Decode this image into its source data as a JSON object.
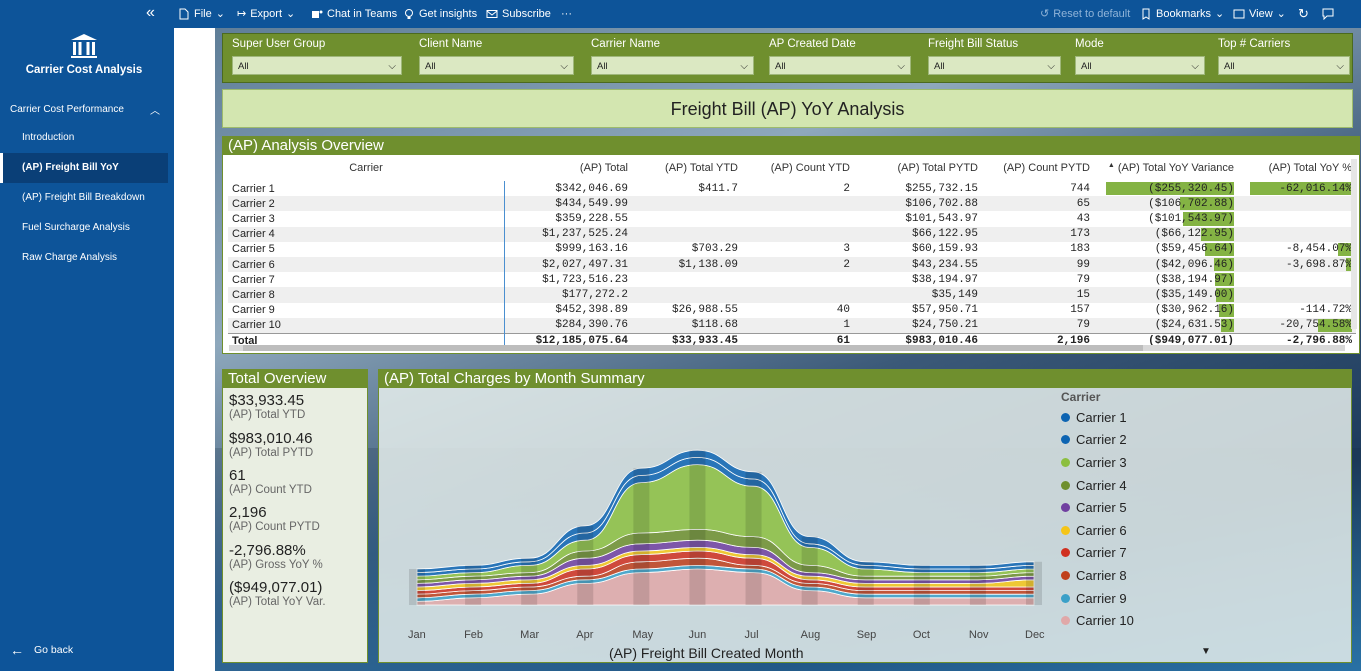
{
  "toolbar": {
    "file": "File",
    "export": "Export",
    "chat": "Chat in Teams",
    "insights": "Get insights",
    "subscribe": "Subscribe",
    "more": "···",
    "reset": "Reset to default",
    "bookmarks": "Bookmarks",
    "view": "View"
  },
  "sidebar": {
    "app_title": "Carrier Cost Analysis",
    "section": "Carrier Cost Performance",
    "items": [
      {
        "label": "Introduction"
      },
      {
        "label": "(AP) Freight Bill YoY"
      },
      {
        "label": "(AP) Freight Bill Breakdown"
      },
      {
        "label": "Fuel Surcharge Analysis"
      },
      {
        "label": "Raw Charge Analysis"
      }
    ],
    "go_back": "Go back"
  },
  "slicers": [
    {
      "label": "Super User Group",
      "value": "All"
    },
    {
      "label": "Client Name",
      "value": "All"
    },
    {
      "label": "Carrier Name",
      "value": "All"
    },
    {
      "label": "AP Created Date",
      "value": "All"
    },
    {
      "label": "Freight Bill Status",
      "value": "All"
    },
    {
      "label": "Mode",
      "value": "All"
    },
    {
      "label": "Top # Carriers",
      "value": "All"
    }
  ],
  "page_title": "Freight Bill (AP) YoY Analysis",
  "overview": {
    "title": "(AP) Analysis Overview",
    "columns": [
      "Carrier",
      "(AP) Total",
      "(AP) Total YTD",
      "(AP) Count YTD",
      "(AP) Total PYTD",
      "(AP) Count PYTD",
      "(AP) Total YoY Variance",
      "(AP) Total YoY %"
    ],
    "rows": [
      {
        "carrier": "Carrier 1",
        "total": "$342,046.69",
        "ytd": "$411.7",
        "count_ytd": "2",
        "pytd": "$255,732.15",
        "count_pytd": "744",
        "variance": "($255,320.45)",
        "var_frac": 1.0,
        "yoy": "-62,016.14%",
        "yoy_frac": 1.0
      },
      {
        "carrier": "Carrier 2",
        "total": "$434,549.99",
        "ytd": "",
        "count_ytd": "",
        "pytd": "$106,702.88",
        "count_pytd": "65",
        "variance": "($106,702.88)",
        "var_frac": 0.42,
        "yoy": "",
        "yoy_frac": 0
      },
      {
        "carrier": "Carrier 3",
        "total": "$359,228.55",
        "ytd": "",
        "count_ytd": "",
        "pytd": "$101,543.97",
        "count_pytd": "43",
        "variance": "($101,543.97)",
        "var_frac": 0.4,
        "yoy": "",
        "yoy_frac": 0
      },
      {
        "carrier": "Carrier 4",
        "total": "$1,237,525.24",
        "ytd": "",
        "count_ytd": "",
        "pytd": "$66,122.95",
        "count_pytd": "173",
        "variance": "($66,122.95)",
        "var_frac": 0.26,
        "yoy": "",
        "yoy_frac": 0
      },
      {
        "carrier": "Carrier 5",
        "total": "$999,163.16",
        "ytd": "$703.29",
        "count_ytd": "3",
        "pytd": "$60,159.93",
        "count_pytd": "183",
        "variance": "($59,456.64)",
        "var_frac": 0.23,
        "yoy": "-8,454.07%",
        "yoy_frac": 0.14
      },
      {
        "carrier": "Carrier 6",
        "total": "$2,027,497.31",
        "ytd": "$1,138.09",
        "count_ytd": "2",
        "pytd": "$43,234.55",
        "count_pytd": "99",
        "variance": "($42,096.46)",
        "var_frac": 0.16,
        "yoy": "-3,698.87%",
        "yoy_frac": 0.06
      },
      {
        "carrier": "Carrier 7",
        "total": "$1,723,516.23",
        "ytd": "",
        "count_ytd": "",
        "pytd": "$38,194.97",
        "count_pytd": "79",
        "variance": "($38,194.97)",
        "var_frac": 0.15,
        "yoy": "",
        "yoy_frac": 0
      },
      {
        "carrier": "Carrier 8",
        "total": "$177,272.2",
        "ytd": "",
        "count_ytd": "",
        "pytd": "$35,149",
        "count_pytd": "15",
        "variance": "($35,149.00)",
        "var_frac": 0.14,
        "yoy": "",
        "yoy_frac": 0
      },
      {
        "carrier": "Carrier 9",
        "total": "$452,398.89",
        "ytd": "$26,988.55",
        "count_ytd": "40",
        "pytd": "$57,950.71",
        "count_pytd": "157",
        "variance": "($30,962.16)",
        "var_frac": 0.12,
        "yoy": "-114.72%",
        "yoy_frac": 0.0
      },
      {
        "carrier": "Carrier 10",
        "total": "$284,390.76",
        "ytd": "$118.68",
        "count_ytd": "1",
        "pytd": "$24,750.21",
        "count_pytd": "79",
        "variance": "($24,631.53)",
        "var_frac": 0.1,
        "yoy": "-20,754.58%",
        "yoy_frac": 0.33
      }
    ],
    "total": {
      "carrier": "Total",
      "total": "$12,185,075.64",
      "ytd": "$33,933.45",
      "count_ytd": "61",
      "pytd": "$983,010.46",
      "count_pytd": "2,196",
      "variance": "($949,077.01)",
      "yoy": "-2,796.88%"
    }
  },
  "kpis": {
    "title": "Total Overview",
    "items": [
      {
        "value": "$33,933.45",
        "label": "(AP) Total YTD"
      },
      {
        "value": "$983,010.46",
        "label": "(AP) Total PYTD"
      },
      {
        "value": "61",
        "label": "(AP) Count YTD"
      },
      {
        "value": "2,196",
        "label": "(AP) Count PYTD"
      },
      {
        "value": "-2,796.88%",
        "label": "(AP) Gross YoY %"
      },
      {
        "value": "($949,077.01)",
        "label": "(AP) Total YoY Var."
      }
    ]
  },
  "chart": {
    "title": "(AP) Total Charges by Month Summary",
    "x_title": "(AP) Freight Bill Created Month",
    "legend_title": "Carrier"
  },
  "chart_data": {
    "type": "area",
    "x": [
      "Jan",
      "Feb",
      "Mar",
      "Apr",
      "May",
      "Jun",
      "Jul",
      "Aug",
      "Sep",
      "Oct",
      "Nov",
      "Dec"
    ],
    "series": [
      {
        "name": "Carrier 1",
        "color": "#0d64b2",
        "values": [
          1,
          1,
          1,
          2,
          2,
          2,
          2,
          2,
          1,
          1,
          1,
          1
        ]
      },
      {
        "name": "Carrier 2",
        "color": "#0d64b2",
        "values": [
          1,
          1,
          1,
          2,
          2,
          2,
          2,
          1,
          1,
          1,
          1,
          1
        ]
      },
      {
        "name": "Carrier 3",
        "color": "#8cbf3f",
        "values": [
          1,
          1,
          2,
          3,
          14,
          18,
          14,
          5,
          2,
          1,
          1,
          1
        ]
      },
      {
        "name": "Carrier 4",
        "color": "#6f8f2e",
        "values": [
          1,
          1,
          1,
          2,
          3,
          3,
          3,
          2,
          1,
          1,
          1,
          1
        ]
      },
      {
        "name": "Carrier 5",
        "color": "#7040a0",
        "values": [
          1,
          1,
          1,
          2,
          2,
          2,
          2,
          1,
          1,
          1,
          1,
          1
        ]
      },
      {
        "name": "Carrier 6",
        "color": "#f5c518",
        "values": [
          1,
          1,
          1,
          1,
          1,
          1,
          1,
          1,
          1,
          1,
          1,
          2
        ]
      },
      {
        "name": "Carrier 7",
        "color": "#d03020",
        "values": [
          1,
          1,
          1,
          2,
          2,
          2,
          2,
          1,
          1,
          1,
          1,
          1
        ]
      },
      {
        "name": "Carrier 8",
        "color": "#c0401c",
        "values": [
          1,
          1,
          1,
          1,
          2,
          2,
          1,
          1,
          1,
          1,
          1,
          1
        ]
      },
      {
        "name": "Carrier 9",
        "color": "#3aa0c8",
        "values": [
          1,
          1,
          1,
          1,
          1,
          1,
          1,
          1,
          1,
          1,
          1,
          1
        ]
      },
      {
        "name": "Carrier 10",
        "color": "#e0a8a8",
        "values": [
          1,
          2,
          3,
          6,
          9,
          10,
          9,
          4,
          2,
          2,
          2,
          2
        ]
      }
    ]
  }
}
